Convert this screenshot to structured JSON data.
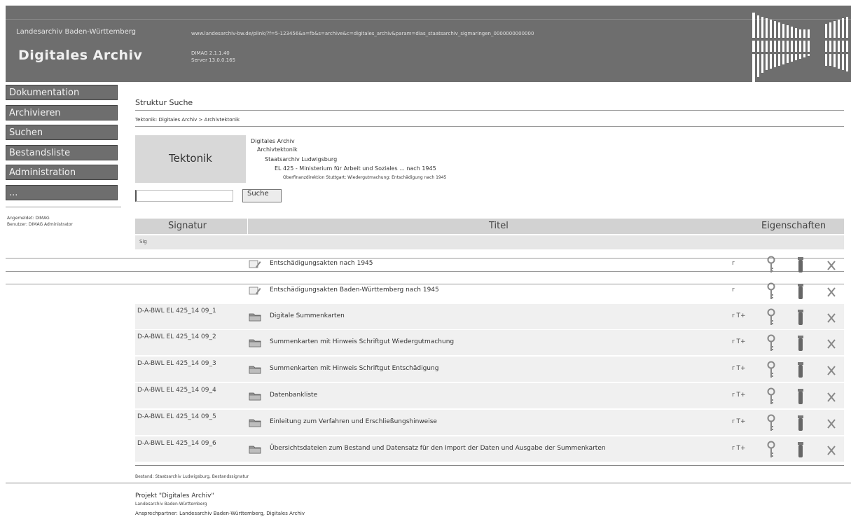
{
  "header": {
    "org": "Landesarchiv Baden-Württemberg",
    "title": "Digitales Archiv",
    "url": "www.landesarchiv-bw.de/plink/?f=5-123456&a=fb&s=archive&c=digitales_archiv&param=dias_staatsarchiv_sigmaringen_0000000000000",
    "version": "DIMAG 2.1.1.40",
    "server": "Server 13.0.0.165"
  },
  "nav": {
    "items": [
      "Dokumentation",
      "Archivieren",
      "Suchen",
      "Bestandsliste",
      "Administration",
      "..."
    ],
    "info1": "Angemeldet: DIMAG",
    "info2": "Benutzer: DIMAG Administrator"
  },
  "main": {
    "heading": "Struktur Suche",
    "path": "Tektonik: Digitales Archiv > Archivtektonik",
    "tektonik_label": "Tektonik",
    "tree": [
      "Digitales Archiv",
      "Archivtektonik",
      "Staatsarchiv Ludwigsburg",
      "EL 425 - Ministerium für Arbeit und Soziales ... nach 1945",
      "Oberfinanzdirektion Stuttgart: Wiedergutmachung: Entschädigung nach 1945"
    ],
    "search": {
      "value": "",
      "button": "Suche"
    },
    "table": {
      "columns": [
        "Signatur",
        "Titel",
        "Eigenschaften"
      ],
      "subheader": "Sig",
      "rows": [
        {
          "sig": "",
          "title": "Entschädigungsakten nach 1945",
          "flag": "r"
        },
        {
          "sig": "",
          "title": "Entschädigungsakten Baden-Württemberg nach 1945",
          "flag": "r"
        },
        {
          "sig": "D-A-BWL EL 425_14 09_1",
          "title": "Digitale Summenkarten",
          "flag": "r T+"
        },
        {
          "sig": "D-A-BWL EL 425_14 09_2",
          "title": "Summenkarten mit Hinweis Schriftgut Wiedergutmachung",
          "flag": "r T+"
        },
        {
          "sig": "D-A-BWL EL 425_14 09_3",
          "title": "Summenkarten mit Hinweis Schriftgut Entschädigung",
          "flag": "r T+"
        },
        {
          "sig": "D-A-BWL EL 425_14 09_4",
          "title": "Datenbankliste",
          "flag": "r T+"
        },
        {
          "sig": "D-A-BWL EL 425_14 09_5",
          "title": "Einleitung zum Verfahren und Erschließungshinweise",
          "flag": "r T+"
        },
        {
          "sig": "D-A-BWL EL 425_14 09_6",
          "title": "Übersichtsdateien zum Bestand und Datensatz für den Import der Daten und Ausgabe der Summenkarten",
          "flag": "r T+"
        }
      ]
    },
    "footnote": "Bestand: Staatsarchiv Ludwigsburg, Bestandssignatur",
    "project_title": "Projekt \"Digitales Archiv\"",
    "project_org": "Landesarchiv Baden-Württemberg",
    "project_contact": "Ansprechpartner: Landesarchiv Baden-Württemberg, Digitales Archiv"
  }
}
